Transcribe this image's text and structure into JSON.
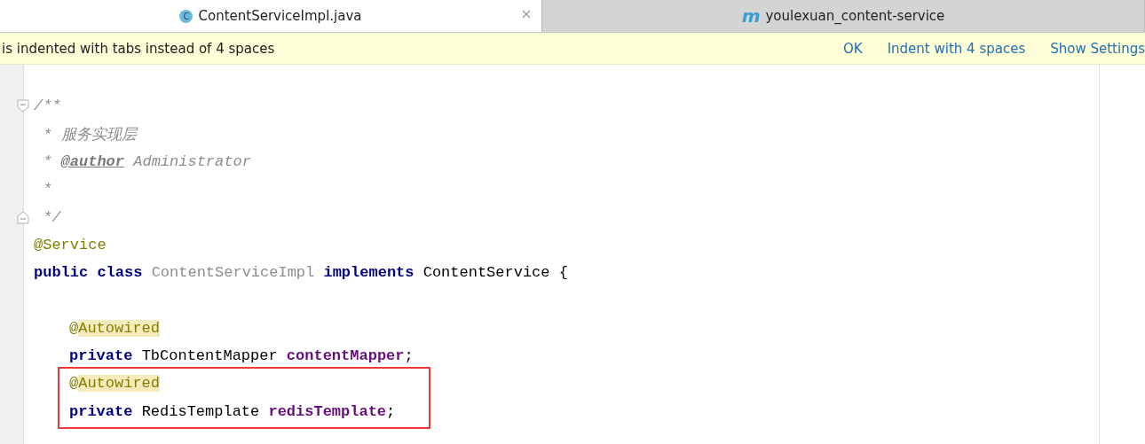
{
  "tabs": [
    {
      "label": "ContentServiceImpl.java",
      "icon": "C",
      "selected": true,
      "closable": true
    },
    {
      "label": "youlexuan_content-service",
      "icon": "m",
      "selected": false,
      "closable": false
    }
  ],
  "notification": {
    "message": "is indented with tabs instead of 4 spaces",
    "actions": [
      "OK",
      "Indent with 4 spaces",
      "Show Settings"
    ]
  },
  "code": {
    "lines": [
      {
        "kind": "blank"
      },
      {
        "kind": "opener",
        "tokens": [
          {
            "kind": "comment",
            "text": "/**"
          }
        ]
      },
      {
        "kind": "top",
        "tokens": [
          {
            "kind": "comment",
            "text": " * 服务实现层"
          }
        ]
      },
      {
        "kind": "top",
        "tokens": [
          {
            "kind": "comment",
            "text": " * "
          },
          {
            "kind": "doctag",
            "text": "@author"
          },
          {
            "kind": "comment",
            "text": " Administrator"
          }
        ]
      },
      {
        "kind": "top",
        "tokens": [
          {
            "kind": "comment",
            "text": " *"
          }
        ]
      },
      {
        "kind": "closer",
        "tokens": [
          {
            "kind": "comment",
            "text": " */"
          }
        ]
      },
      {
        "kind": "top",
        "tokens": [
          {
            "kind": "annotation",
            "text": "@Service"
          }
        ]
      },
      {
        "kind": "top",
        "tokens": [
          {
            "kind": "keyword",
            "text": "public class "
          },
          {
            "kind": "unused",
            "text": "ContentServiceImpl "
          },
          {
            "kind": "keyword",
            "text": "implements "
          },
          {
            "kind": "plain",
            "text": "ContentService {"
          }
        ]
      },
      {
        "kind": "blank"
      },
      {
        "kind": "member",
        "tokens": [
          {
            "kind": "annotation",
            "text": "@"
          },
          {
            "kind": "marked",
            "text": "Autowired"
          }
        ]
      },
      {
        "kind": "member",
        "tokens": [
          {
            "kind": "keyword",
            "text": "private "
          },
          {
            "kind": "plain",
            "text": "TbContentMapper "
          },
          {
            "kind": "field",
            "text": "contentMapper"
          },
          {
            "kind": "plain",
            "text": ";"
          }
        ]
      },
      {
        "kind": "frame",
        "lines": [
          {
            "kind": "member",
            "tokens": [
              {
                "kind": "annotation",
                "text": "@"
              },
              {
                "kind": "marked",
                "text": "Autowired"
              }
            ]
          },
          {
            "kind": "member",
            "tokens": [
              {
                "kind": "keyword",
                "text": "private "
              },
              {
                "kind": "plain",
                "text": "RedisTemplate "
              },
              {
                "kind": "field",
                "text": "redisTemplate"
              },
              {
                "kind": "plain",
                "text": ";"
              }
            ]
          }
        ]
      }
    ]
  }
}
